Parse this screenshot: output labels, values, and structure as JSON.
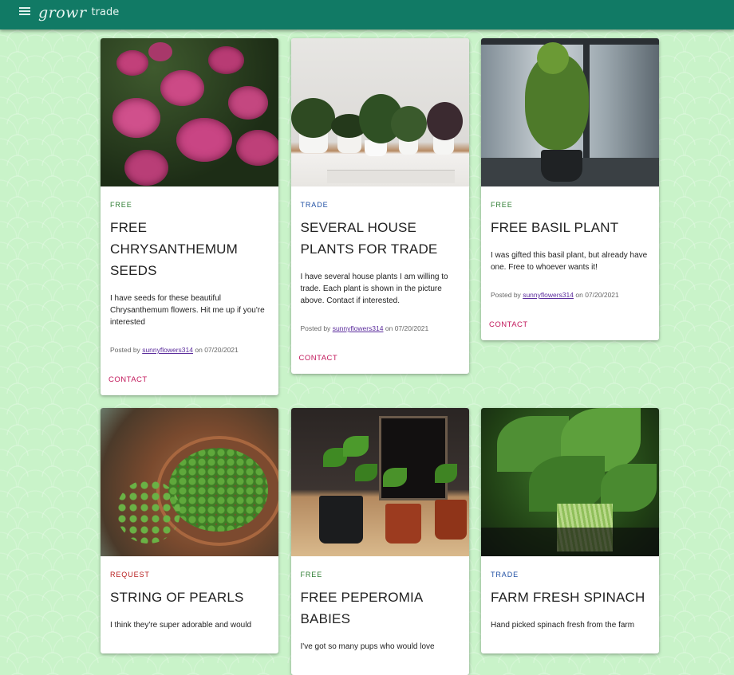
{
  "header": {
    "brand_script": "growr",
    "brand_word": "trade"
  },
  "listings": [
    {
      "tag": "FREE",
      "tag_type": "free",
      "title": "FREE CHRYSANTHEMUM SEEDS",
      "description": "I have seeds for these beautiful Chrysanthemum flowers. Hit me up if you're interested",
      "posted_prefix": "Posted by",
      "user": "sunnyflowers314",
      "date_prefix": "on",
      "date": "07/20/2021",
      "action": "CONTACT",
      "image": "chrysanthemum-flowers"
    },
    {
      "tag": "TRADE",
      "tag_type": "trade",
      "title": "SEVERAL HOUSE PLANTS FOR TRADE",
      "description": "I have several house plants I am willing to trade. Each plant is shown in the picture above. Contact if interested.",
      "posted_prefix": "Posted by",
      "user": "sunnyflowers314",
      "date_prefix": "on",
      "date": "07/20/2021",
      "action": "CONTACT",
      "image": "house-plants-on-shelf"
    },
    {
      "tag": "FREE",
      "tag_type": "free",
      "title": "FREE BASIL PLANT",
      "description": "I was gifted this basil plant, but already have one. Free to whoever wants it!",
      "posted_prefix": "Posted by",
      "user": "sunnyflowers314",
      "date_prefix": "on",
      "date": "07/20/2021",
      "action": "CONTACT",
      "image": "basil-plant-window"
    },
    {
      "tag": "REQUEST",
      "tag_type": "request",
      "title": "STRING OF PEARLS",
      "description": "I think they're super adorable and would",
      "image": "string-of-pearls"
    },
    {
      "tag": "FREE",
      "tag_type": "free",
      "title": "FREE PEPEROMIA BABIES",
      "description": "I've got so many pups who would love",
      "image": "peperomia-pots"
    },
    {
      "tag": "TRADE",
      "tag_type": "trade",
      "title": "FARM FRESH SPINACH",
      "description": "Hand picked spinach fresh from the farm",
      "image": "spinach-bunch"
    }
  ],
  "colors": {
    "appbar": "#117a65",
    "background": "#c9f3c9",
    "free": "#2e7d32",
    "trade": "#1f4fa3",
    "request": "#b71c1c",
    "contact": "#c2185b"
  }
}
